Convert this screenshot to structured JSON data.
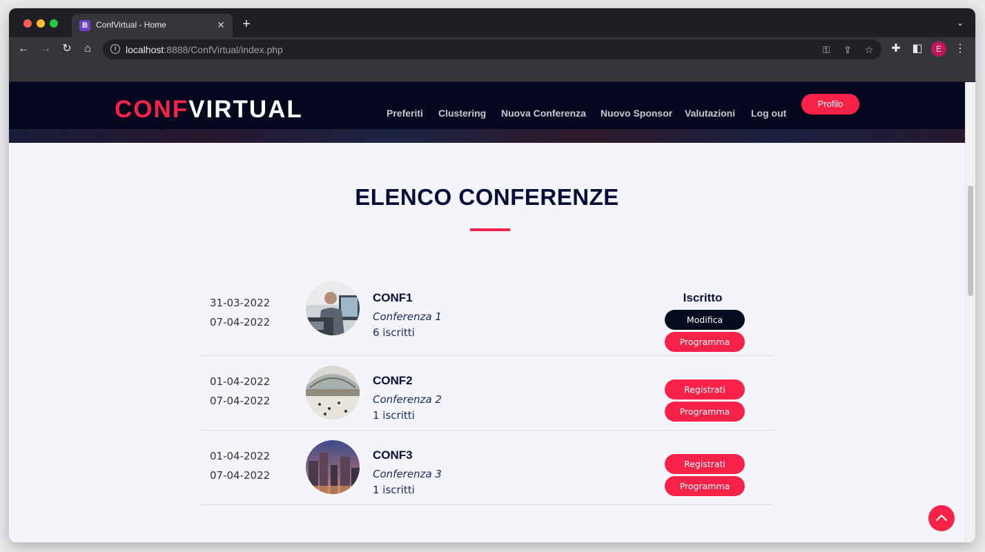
{
  "browser": {
    "tab_title": "ConfVirtual - Home",
    "favicon_letter": "B",
    "url_host": "localhost",
    "url_rest": ":8888/ConfVirtual/index.php",
    "profile_letter": "E"
  },
  "site": {
    "logo_part1": "CONF",
    "logo_part2": "VIRTUAL",
    "nav": [
      "Preferiti",
      "Clustering",
      "Nuova Conferenza",
      "Nuovo Sponsor",
      "Valutazioni",
      "Log out"
    ],
    "profile_button": "Profilo"
  },
  "main": {
    "title": "ELENCO CONFERENZE",
    "conferences": [
      {
        "start_date": "31-03-2022",
        "end_date": "07-04-2022",
        "name": "CONF1",
        "description": "Conferenza 1",
        "subscribers": "6 iscritti",
        "status": "Iscritto",
        "primary_button": "Modifica",
        "secondary_button": "Programma"
      },
      {
        "start_date": "01-04-2022",
        "end_date": "07-04-2022",
        "name": "CONF2",
        "description": "Conferenza 2",
        "subscribers": "1 iscritti",
        "status": "",
        "primary_button": "Registrati",
        "secondary_button": "Programma"
      },
      {
        "start_date": "01-04-2022",
        "end_date": "07-04-2022",
        "name": "CONF3",
        "description": "Conferenza 3",
        "subscribers": "1 iscritti",
        "status": "",
        "primary_button": "Registrati",
        "secondary_button": "Programma"
      }
    ]
  },
  "colors": {
    "accent": "#f82249",
    "navy": "#060c37",
    "header_bg": "#05081f"
  }
}
